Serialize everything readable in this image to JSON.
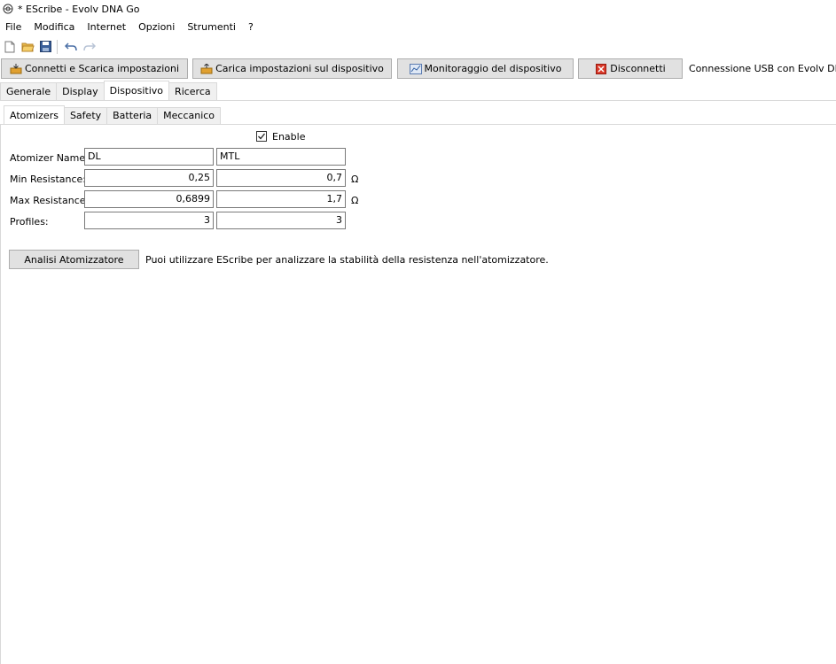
{
  "window": {
    "title": "* EScribe - Evolv DNA Go"
  },
  "menu": {
    "items": [
      "File",
      "Modifica",
      "Internet",
      "Opzioni",
      "Strumenti",
      "?"
    ]
  },
  "toolbar": {
    "icons": [
      "new-file-icon",
      "open-folder-icon",
      "save-icon",
      "undo-icon",
      "redo-icon"
    ],
    "connect_label": "Connetti e Scarica impostazioni",
    "upload_label": "Carica impostazioni sul dispositivo",
    "monitor_label": "Monitoraggio del dispositivo",
    "disconnect_label": "Disconnetti",
    "connection_status": "Connessione USB con Evolv DNA Go"
  },
  "tabs": {
    "main": [
      "Generale",
      "Display",
      "Dispositivo",
      "Ricerca"
    ],
    "main_active": "Dispositivo",
    "sub": [
      "Atomizers",
      "Safety",
      "Batteria",
      "Meccanico"
    ],
    "sub_active": "Atomizers"
  },
  "atomizers": {
    "enable_label": "Enable",
    "enable_checked": true,
    "labels": {
      "name": "Atomizer Name:",
      "min_res": "Min Resistance:",
      "max_res": "Max Resistance:",
      "profiles": "Profiles:"
    },
    "unit": "Ω",
    "col1": {
      "name": "DL",
      "min_res": "0,25",
      "max_res": "0,6899",
      "profiles": "3"
    },
    "col2": {
      "name": "MTL",
      "min_res": "0,7",
      "max_res": "1,7",
      "profiles": "3"
    }
  },
  "analysis": {
    "button_label": "Analisi Atomizzatore",
    "description": "Puoi utilizzare EScribe per analizzare la stabilità della resistenza nell'atomizzatore."
  }
}
